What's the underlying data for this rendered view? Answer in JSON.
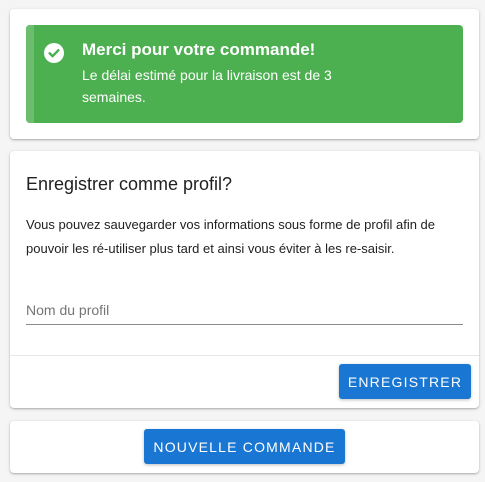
{
  "colors": {
    "success": "#4caf50",
    "primary": "#1976d2"
  },
  "alert": {
    "icon": "check-circle-icon",
    "title": "Merci pour votre commande!",
    "message": "Le délai estimé pour la livraison est de 3 semaines."
  },
  "profile": {
    "title": "Enregistrer comme profil?",
    "description": "Vous pouvez sauvegarder vos informations sous forme de profil afin de pouvoir les ré-utiliser plus tard et ainsi vous éviter à les re-saisir.",
    "name_placeholder": "Nom du profil",
    "name_value": "",
    "save_label": "ENREGISTRER"
  },
  "actions": {
    "new_order_label": "NOUVELLE COMMANDE"
  }
}
